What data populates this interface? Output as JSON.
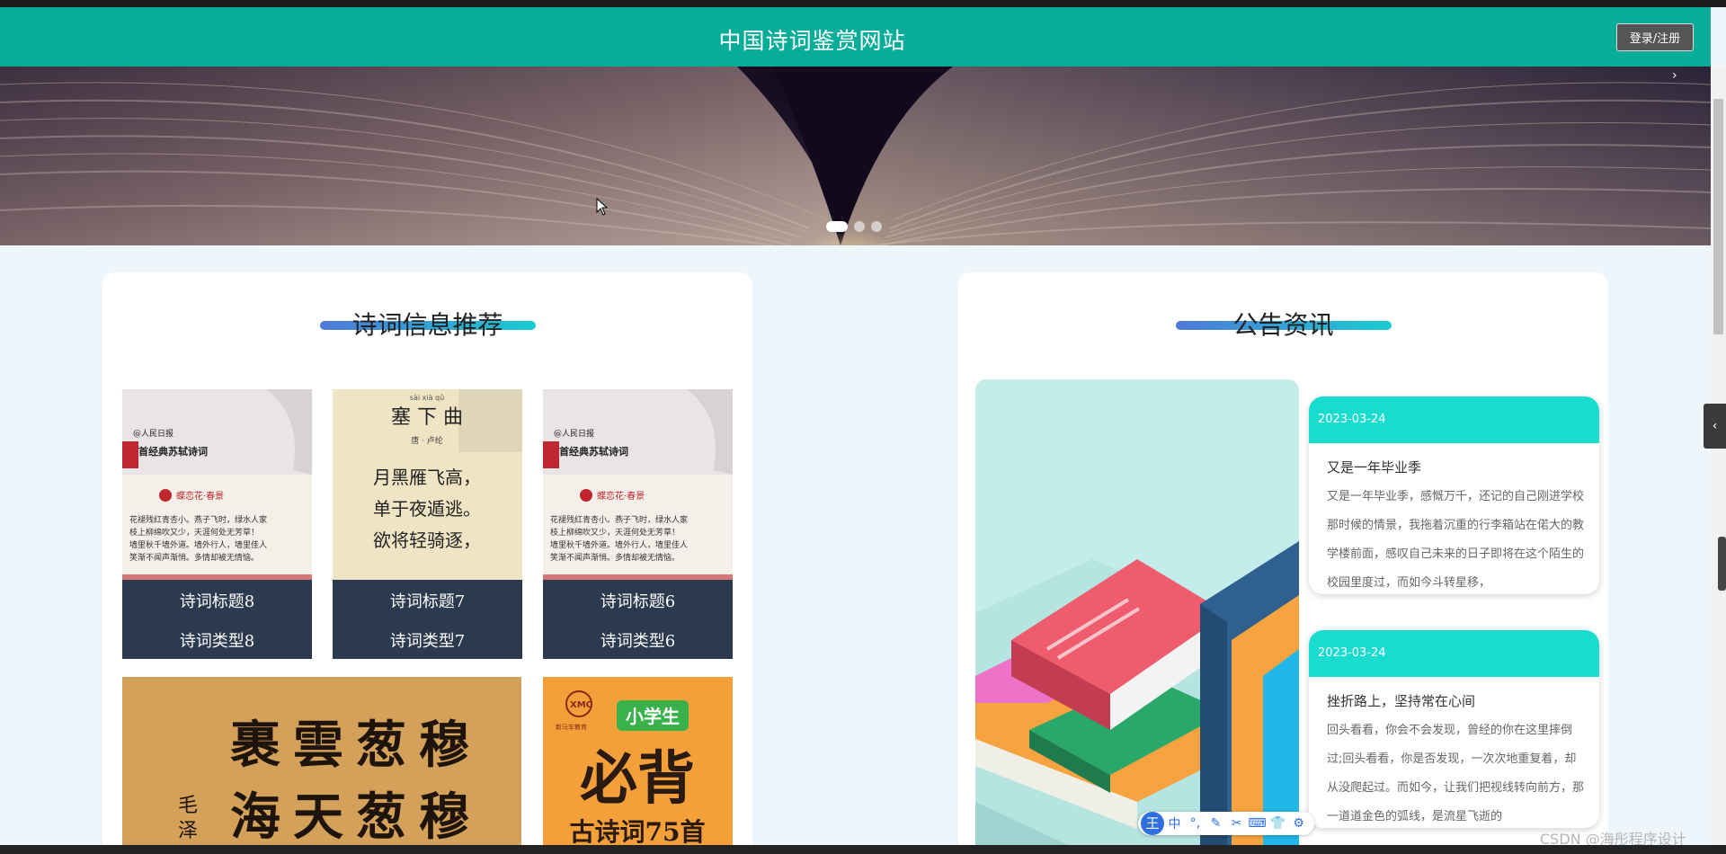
{
  "header": {
    "site_title": "中国诗词鉴赏网站",
    "login_label": "登录/注册"
  },
  "banner": {
    "slide_count": 3,
    "active_slide": 1
  },
  "poems": {
    "title": "诗词信息推荐",
    "items": [
      {
        "title": "诗词标题8",
        "type": "诗词类型8",
        "image": "人民日报 10首经典苏轼诗词 蝶恋花·春景"
      },
      {
        "title": "诗词标题7",
        "type": "诗词类型7",
        "image": "塞下曲 唐·卢纶 月黑雁飞高 单于夜遁逃 欲将轻骑逐"
      },
      {
        "title": "诗词标题6",
        "type": "诗词类型6",
        "image": "人民日报 10首经典苏轼诗词 蝶恋花·春景"
      }
    ],
    "posters": [
      {
        "text": "裹雲葱穆 海天葱穆",
        "signature": "毛泽"
      },
      {
        "badge": "小学生",
        "headline": "必背",
        "subline": "古诗词75首",
        "logo": "XMC"
      }
    ]
  },
  "news": {
    "title": "公告资讯",
    "items": [
      {
        "date": "2023-03-24",
        "title": "又是一年毕业季",
        "body": "又是一年毕业季，感慨万千，还记的自己刚进学校那时候的情景，我拖着沉重的行李箱站在偌大的教学楼前面，感叹自己未来的日子即将在这个陌生的校园里度过，而如今斗转星移，"
      },
      {
        "date": "2023-03-24",
        "title": "挫折路上，坚持常在心间",
        "body": "回头看看，你会不会发现，曾经的你在这里摔倒过;回头看看，你是否发现，一次次地重复着，却从没爬起过。而如今，让我们把视线转向前方，那一道道金色的弧线，是流星飞逝的"
      }
    ]
  },
  "ime": {
    "logo": "王",
    "items": [
      "中",
      "°,",
      "✎",
      "✂",
      "⌨",
      "👕",
      "⚙"
    ]
  },
  "watermark": "CSDN @海彤程序设计",
  "side_toggle": "‹"
}
